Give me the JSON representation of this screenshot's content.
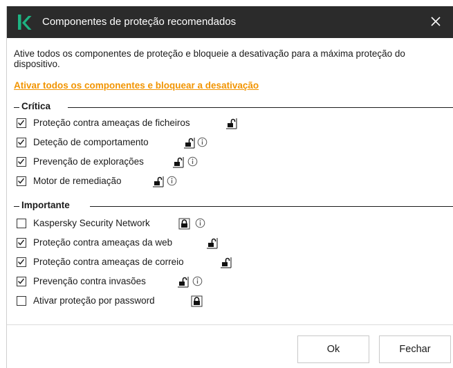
{
  "dialog": {
    "title": "Componentes de proteção recomendados",
    "intro": "Ative todos os componentes de proteção e bloqueie a desativação para a máxima proteção do dispositivo.",
    "link": "Ativar todos os componentes e bloquear a desativação",
    "colors": {
      "titlebar": "#2b2b2b",
      "logo": "#1db382",
      "link": "#f29400"
    }
  },
  "sections": {
    "critica": {
      "label": "Crítica"
    },
    "importante": {
      "label": "Importante"
    }
  },
  "items": [
    {
      "label": "Proteção contra ameaças de ficheiros",
      "checked": true,
      "lock": "unlocked",
      "info": false
    },
    {
      "label": "Deteção de comportamento",
      "checked": true,
      "lock": "unlocked",
      "info": true
    },
    {
      "label": "Prevenção de explorações",
      "checked": true,
      "lock": "unlocked",
      "info": true
    },
    {
      "label": "Motor de remediação",
      "checked": true,
      "lock": "unlocked",
      "info": true
    },
    {
      "label": "Kaspersky Security Network",
      "checked": false,
      "lock": "locked",
      "info": true
    },
    {
      "label": "Proteção contra ameaças da web",
      "checked": true,
      "lock": "unlocked",
      "info": false
    },
    {
      "label": "Proteção contra ameaças de correio",
      "checked": true,
      "lock": "unlocked",
      "info": false
    },
    {
      "label": "Prevenção contra invasões",
      "checked": true,
      "lock": "unlocked",
      "info": true
    },
    {
      "label": "Ativar proteção por password",
      "checked": false,
      "lock": "locked",
      "info": false
    }
  ],
  "buttons": {
    "ok": "Ok",
    "close": "Fechar"
  }
}
